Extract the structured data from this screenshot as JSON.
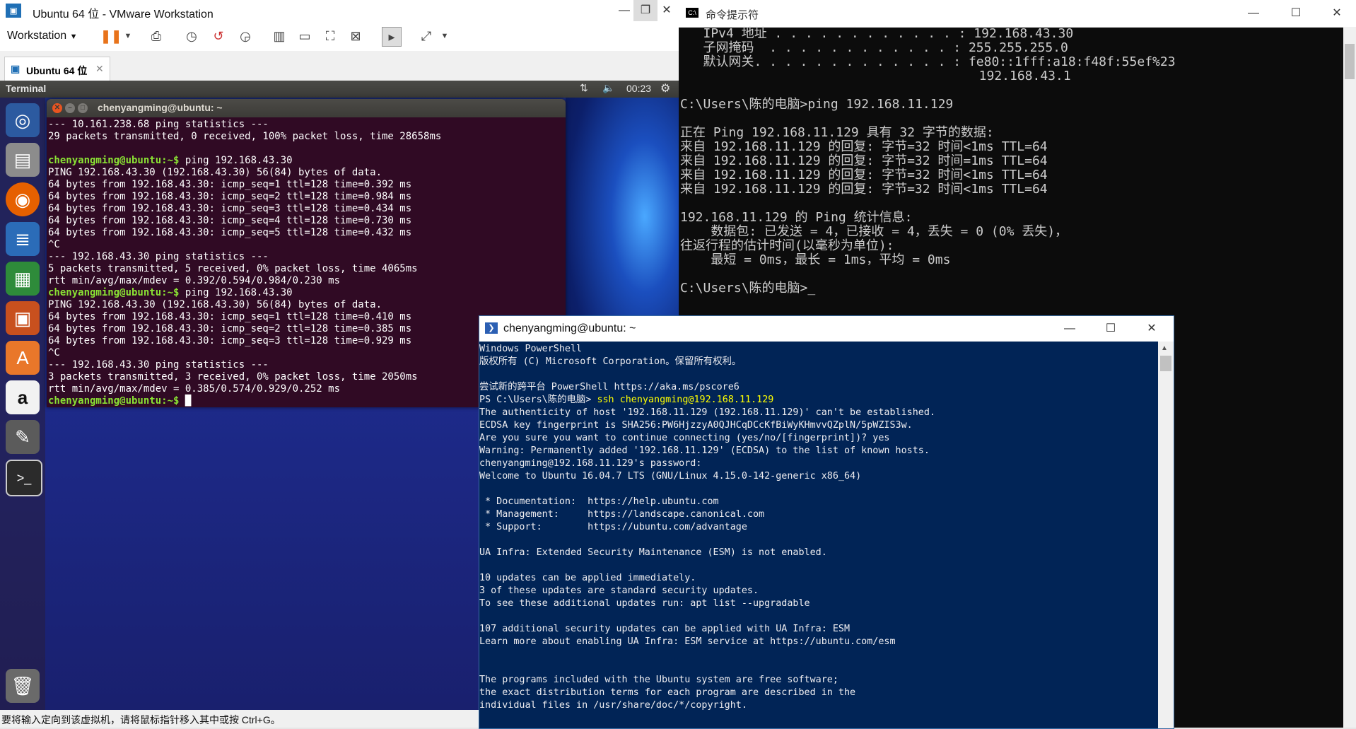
{
  "vmware": {
    "title": "Ubuntu 64 位 - VMware Workstation",
    "menu_label": "Workstation",
    "tab_label": "Ubuntu 64 位",
    "statusbar_text": "要将输入定向到该虚拟机，请将鼠标指针移入其中或按 Ctrl+G。",
    "toolbar_icons": [
      "pause-icon",
      "dropdown-icon",
      "send-keys-icon",
      "snapshot-icon",
      "revert-snapshot-icon",
      "manage-snapshots-icon",
      "console-view-icon",
      "fullscreen-icon",
      "unity-icon",
      "terminal-view-icon",
      "stretch-icon"
    ]
  },
  "ubuntu": {
    "panel_app": "Terminal",
    "panel_time": "00:23",
    "launcher_icons": [
      "ubuntu-dash-icon",
      "files-icon",
      "firefox-icon",
      "writer-icon",
      "calc-icon",
      "impress-icon",
      "software-center-icon",
      "amazon-icon",
      "system-settings-icon",
      "terminal-icon",
      "trash-icon"
    ],
    "terminal": {
      "title": "chenyangming@ubuntu: ~",
      "lines": [
        {
          "t": "--- 10.161.238.68 ping statistics ---"
        },
        {
          "t": "29 packets transmitted, 0 received, 100% packet loss, time 28658ms"
        },
        {
          "t": ""
        },
        {
          "p": "chenyangming@ubuntu:~$",
          "t": " ping 192.168.43.30"
        },
        {
          "t": "PING 192.168.43.30 (192.168.43.30) 56(84) bytes of data."
        },
        {
          "t": "64 bytes from 192.168.43.30: icmp_seq=1 ttl=128 time=0.392 ms"
        },
        {
          "t": "64 bytes from 192.168.43.30: icmp_seq=2 ttl=128 time=0.984 ms"
        },
        {
          "t": "64 bytes from 192.168.43.30: icmp_seq=3 ttl=128 time=0.434 ms"
        },
        {
          "t": "64 bytes from 192.168.43.30: icmp_seq=4 ttl=128 time=0.730 ms"
        },
        {
          "t": "64 bytes from 192.168.43.30: icmp_seq=5 ttl=128 time=0.432 ms"
        },
        {
          "t": "^C"
        },
        {
          "t": "--- 192.168.43.30 ping statistics ---"
        },
        {
          "t": "5 packets transmitted, 5 received, 0% packet loss, time 4065ms"
        },
        {
          "t": "rtt min/avg/max/mdev = 0.392/0.594/0.984/0.230 ms"
        },
        {
          "p": "chenyangming@ubuntu:~$",
          "t": " ping 192.168.43.30"
        },
        {
          "t": "PING 192.168.43.30 (192.168.43.30) 56(84) bytes of data."
        },
        {
          "t": "64 bytes from 192.168.43.30: icmp_seq=1 ttl=128 time=0.410 ms"
        },
        {
          "t": "64 bytes from 192.168.43.30: icmp_seq=2 ttl=128 time=0.385 ms"
        },
        {
          "t": "64 bytes from 192.168.43.30: icmp_seq=3 ttl=128 time=0.929 ms"
        },
        {
          "t": "^C"
        },
        {
          "t": "--- 192.168.43.30 ping statistics ---"
        },
        {
          "t": "3 packets transmitted, 3 received, 0% packet loss, time 2050ms"
        },
        {
          "t": "rtt min/avg/max/mdev = 0.385/0.574/0.929/0.252 ms"
        },
        {
          "p": "chenyangming@ubuntu:~$",
          "t": " █"
        }
      ]
    }
  },
  "cmd": {
    "title": "命令提示符",
    "text": "   IPv4 地址 . . . . . . . . . . . . : 192.168.43.30\n   子网掩码  . . . . . . . . . . . . : 255.255.255.0\n   默认网关. . . . . . . . . . . . . : fe80::1fff:a18:f48f:55ef%23\n                                       192.168.43.1\n\nC:\\Users\\陈的电脑>ping 192.168.11.129\n\n正在 Ping 192.168.11.129 具有 32 字节的数据:\n来自 192.168.11.129 的回复: 字节=32 时间<1ms TTL=64\n来自 192.168.11.129 的回复: 字节=32 时间=1ms TTL=64\n来自 192.168.11.129 的回复: 字节=32 时间<1ms TTL=64\n来自 192.168.11.129 的回复: 字节=32 时间<1ms TTL=64\n\n192.168.11.129 的 Ping 统计信息:\n    数据包: 已发送 = 4，已接收 = 4，丢失 = 0 (0% 丢失)，\n往返行程的估计时间(以毫秒为单位):\n    最短 = 0ms，最长 = 1ms，平均 = 0ms\n\nC:\\Users\\陈的电脑>_"
  },
  "powershell": {
    "title": "chenyangming@ubuntu: ~",
    "prompt_prefix": "PS C:\\Users\\陈的电脑> ",
    "command": "ssh chenyangming@192.168.11.129",
    "text_before": "Windows PowerShell\n版权所有 (C) Microsoft Corporation。保留所有权利。\n\n尝试新的跨平台 PowerShell https://aka.ms/pscore6\n",
    "text_after": "The authenticity of host '192.168.11.129 (192.168.11.129)' can't be established.\nECDSA key fingerprint is SHA256:PW6HjzzyA0QJHCqDCcKfBiWyKHmvvQZplN/5pWZIS3w.\nAre you sure you want to continue connecting (yes/no/[fingerprint])? yes\nWarning: Permanently added '192.168.11.129' (ECDSA) to the list of known hosts.\nchenyangming@192.168.11.129's password:\nWelcome to Ubuntu 16.04.7 LTS (GNU/Linux 4.15.0-142-generic x86_64)\n\n * Documentation:  https://help.ubuntu.com\n * Management:     https://landscape.canonical.com\n * Support:        https://ubuntu.com/advantage\n\nUA Infra: Extended Security Maintenance (ESM) is not enabled.\n\n10 updates can be applied immediately.\n3 of these updates are standard security updates.\nTo see these additional updates run: apt list --upgradable\n\n107 additional security updates can be applied with UA Infra: ESM\nLearn more about enabling UA Infra: ESM service at https://ubuntu.com/esm\n\n\nThe programs included with the Ubuntu system are free software;\nthe exact distribution terms for each program are described in the\nindividual files in /usr/share/doc/*/copyright."
  }
}
